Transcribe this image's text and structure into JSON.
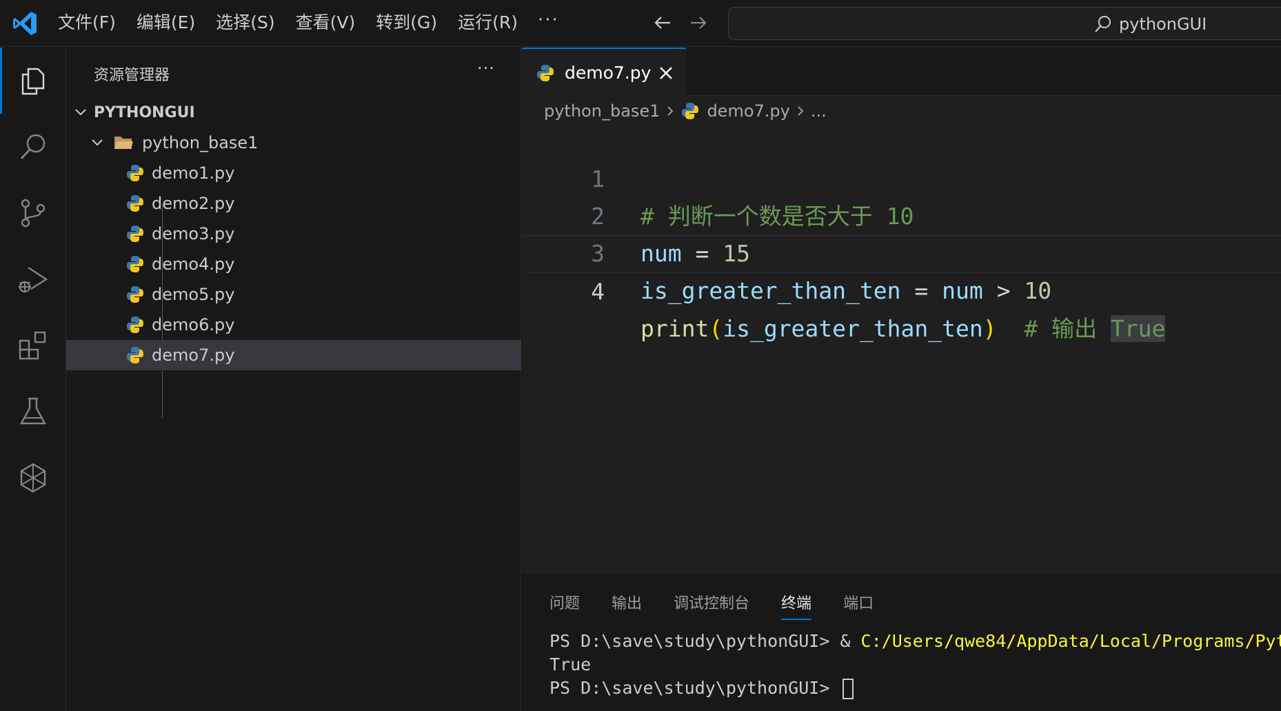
{
  "menu": [
    "文件(F)",
    "编辑(E)",
    "选择(S)",
    "查看(V)",
    "转到(G)",
    "运行(R)"
  ],
  "menu_more": "···",
  "search": {
    "text": "pythonGUI"
  },
  "activity": [
    "explorer-icon",
    "search-icon",
    "source-control-icon",
    "run-debug-icon",
    "extensions-icon",
    "testing-icon",
    "copilot-icon"
  ],
  "sidebar": {
    "title": "资源管理器",
    "more": "···",
    "project": "PYTHONGUI",
    "folder": "python_base1",
    "files": [
      "demo1.py",
      "demo2.py",
      "demo3.py",
      "demo4.py",
      "demo5.py",
      "demo6.py",
      "demo7.py"
    ]
  },
  "editor": {
    "tab": "demo7.py",
    "breadcrumb": {
      "folder": "python_base1",
      "file": "demo7.py",
      "more": "..."
    },
    "line_numbers": [
      "1",
      "2",
      "3",
      "4"
    ],
    "lines": [
      {
        "comment": "# 判断一个数是否大于 10"
      },
      {
        "var": "num",
        "op": " = ",
        "num": "15"
      },
      {
        "var": "is_greater_than_ten",
        "op1": " = ",
        "var2": "num",
        "op2": " > ",
        "num": "10"
      },
      {
        "fn": "print",
        "lp": "(",
        "arg": "is_greater_than_ten",
        "rp": ")",
        "comment": "  # 输出 ",
        "hl": "True"
      }
    ]
  },
  "panel": {
    "tabs": [
      "问题",
      "输出",
      "调试控制台",
      "终端",
      "端口"
    ],
    "terminal": {
      "prompt1": "PS D:\\save\\study\\pythonGUI> ",
      "amp": "& ",
      "cmd_path": "C:/Users/qwe84/AppData/Local/Programs/Pyt",
      "output": "True",
      "prompt2": "PS D:\\save\\study\\pythonGUI> "
    }
  },
  "colors": {
    "accent": "#0078d4",
    "background": "#181818",
    "editor": "#1f1f1f"
  }
}
